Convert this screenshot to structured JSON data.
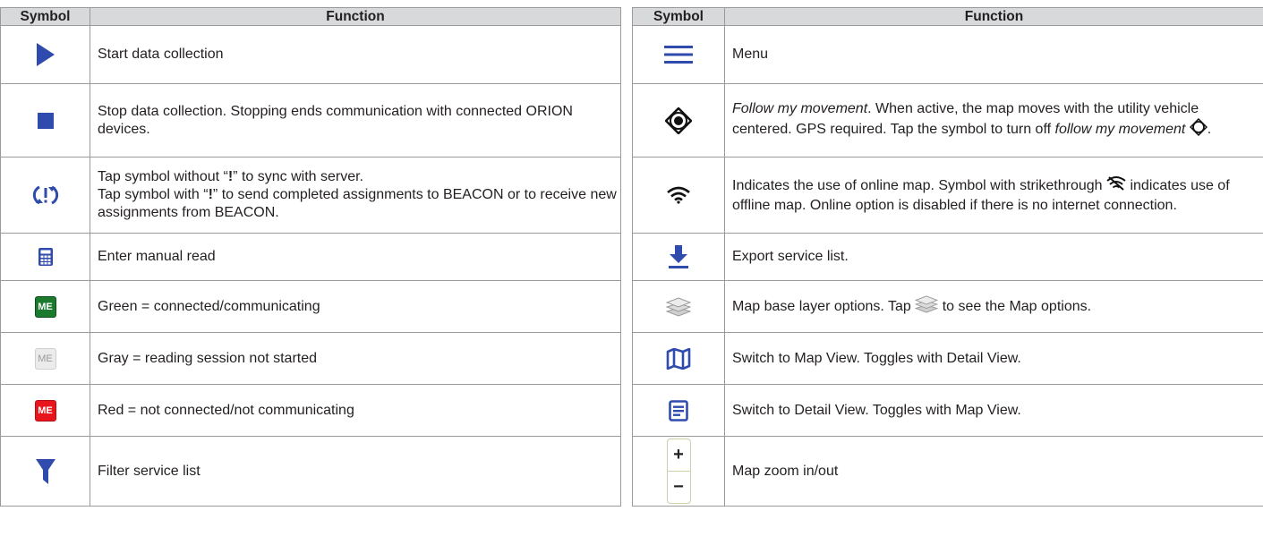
{
  "headers": {
    "symbol": "Symbol",
    "function": "Function"
  },
  "left": {
    "rows": [
      {
        "icon": "play-triangle-icon",
        "text": "Start data collection"
      },
      {
        "icon": "stop-square-icon",
        "text": "Stop data collection. Stopping ends communication with connected ORION devices."
      },
      {
        "icon": "sync-exclamation-icon",
        "line1_pre": "Tap symbol without “",
        "line1_bold": "!",
        "line1_post": "” to sync with server.",
        "line2_pre": "Tap symbol with “",
        "line2_bold": "!",
        "line2_post": "” to send completed assignments to BEACON or to receive new assignments from BEACON."
      },
      {
        "icon": "calculator-icon",
        "text": "Enter manual read"
      },
      {
        "icon": "me-green-badge",
        "badge": "ME",
        "text": "Green = connected/communicating"
      },
      {
        "icon": "me-gray-badge",
        "badge": "ME",
        "text": "Gray = reading session not started"
      },
      {
        "icon": "me-red-badge",
        "badge": "ME",
        "text": "Red = not connected/not communicating"
      },
      {
        "icon": "filter-funnel-icon",
        "text": "Filter service list"
      }
    ]
  },
  "right": {
    "rows": [
      {
        "icon": "menu-hamburger-icon",
        "text": "Menu"
      },
      {
        "icon": "follow-location-icon",
        "italic1": "Follow my movement",
        "text1": ". When active, the map moves with the utility vehicle centered. GPS required. Tap the symbol to turn off ",
        "italic2": "follow my movement",
        "text2": "."
      },
      {
        "icon": "wifi-icon",
        "text1": "Indicates the use of online map. Symbol with strikethrough",
        "text2": "indicates use of offline map. Online option is disabled if there is no internet connection."
      },
      {
        "icon": "download-arrow-icon",
        "text": "Export service list."
      },
      {
        "icon": "layers-icon",
        "text1": "Map base layer options. Tap",
        "text2": "to see the Map options."
      },
      {
        "icon": "map-view-icon",
        "text": "Switch to Map View. Toggles with Detail View."
      },
      {
        "icon": "detail-view-icon",
        "text": "Switch to Detail View. Toggles with Map View."
      },
      {
        "icon": "zoom-control-icon",
        "plus": "+",
        "minus": "−",
        "text": "Map zoom in/out"
      }
    ]
  },
  "colors": {
    "header_bg": "#d8d9db",
    "icon_blue": "#2f4bad",
    "border": "#9a9a9a"
  }
}
